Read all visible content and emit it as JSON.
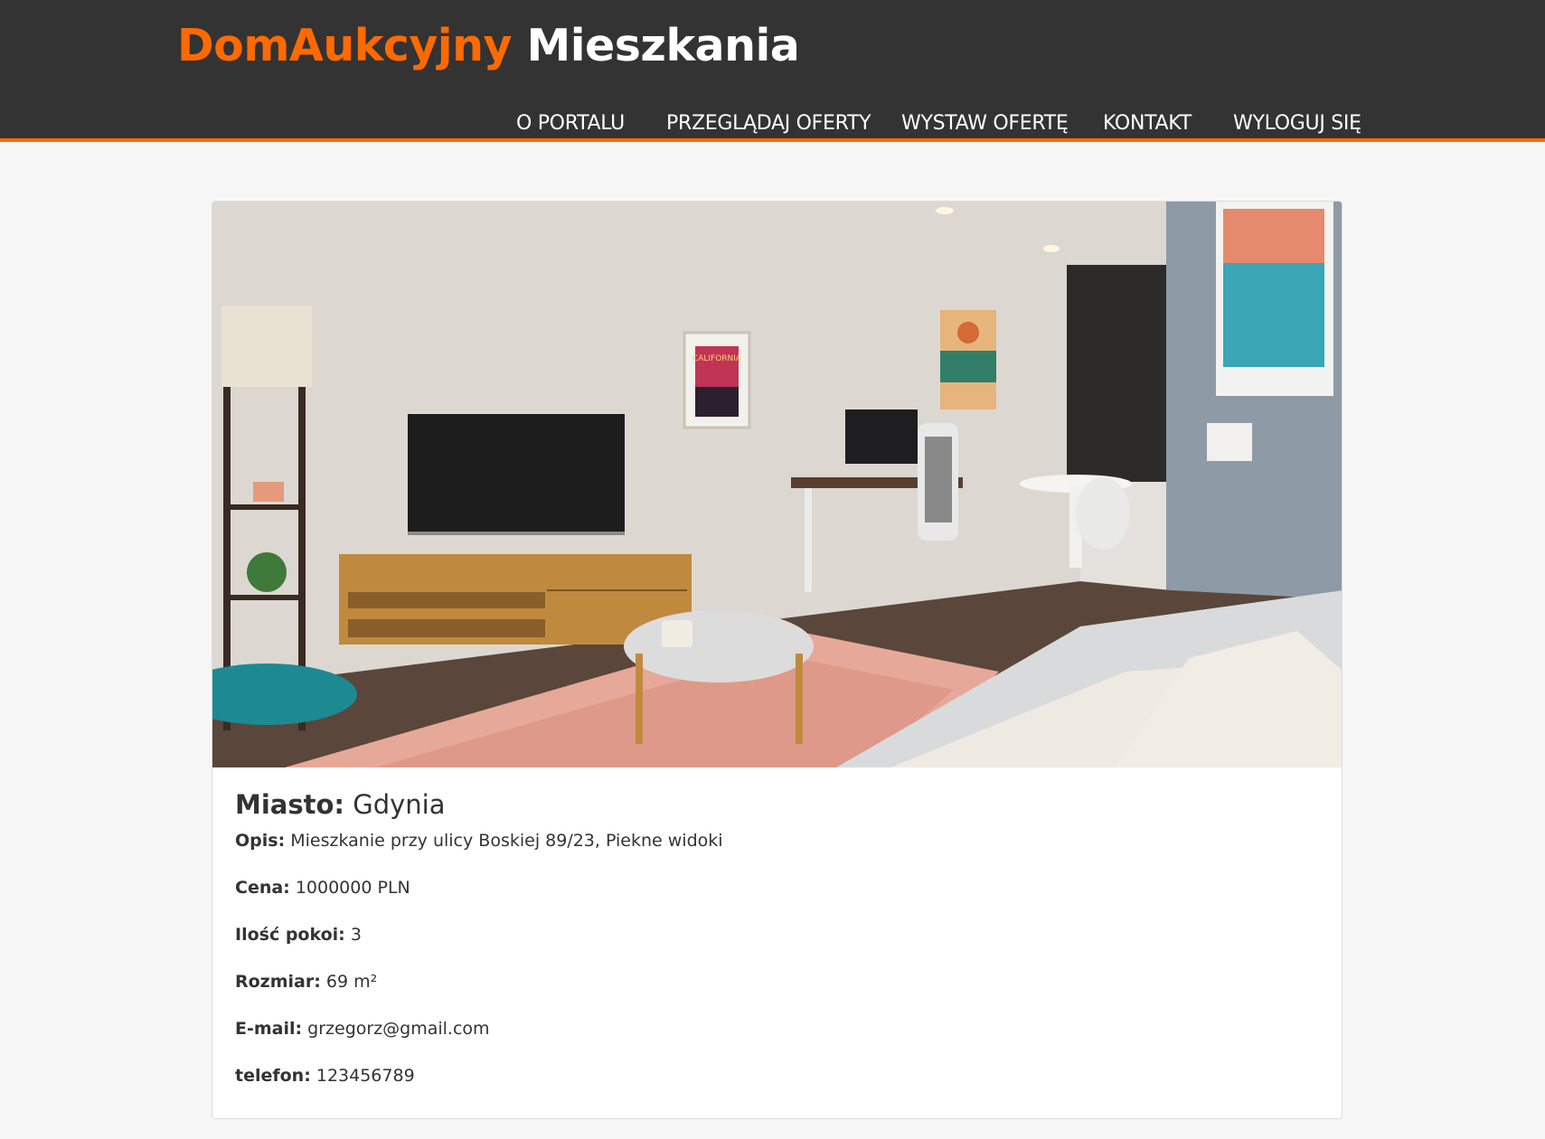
{
  "header": {
    "brand_part1": "DomAukcyjny",
    "brand_part2": "Mieszkania",
    "accent_color": "#ff6a00",
    "background_color": "#333333"
  },
  "nav": {
    "items": [
      {
        "label": "O PORTALU"
      },
      {
        "label": "PRZEGLĄDAJ OFERTY"
      },
      {
        "label": "WYSTAW OFERTĘ"
      },
      {
        "label": "KONTAKT"
      },
      {
        "label": "WYLOGUJ SIĘ"
      }
    ]
  },
  "listing": {
    "photo_art_text": "CALIFORNIA",
    "city_label": "Miasto:",
    "city_value": "Gdynia",
    "fields": [
      {
        "label": "Opis:",
        "value": "Mieszkanie przy ulicy Boskiej 89/23, Piekne widoki"
      },
      {
        "label": "Cena:",
        "value": "1000000 PLN"
      },
      {
        "label": "Ilość pokoi:",
        "value": "3"
      },
      {
        "label": "Rozmiar:",
        "value": "69 m²"
      },
      {
        "label": "E-mail:",
        "value": "grzegorz@gmail.com"
      },
      {
        "label": "telefon:",
        "value": "123456789"
      }
    ]
  }
}
